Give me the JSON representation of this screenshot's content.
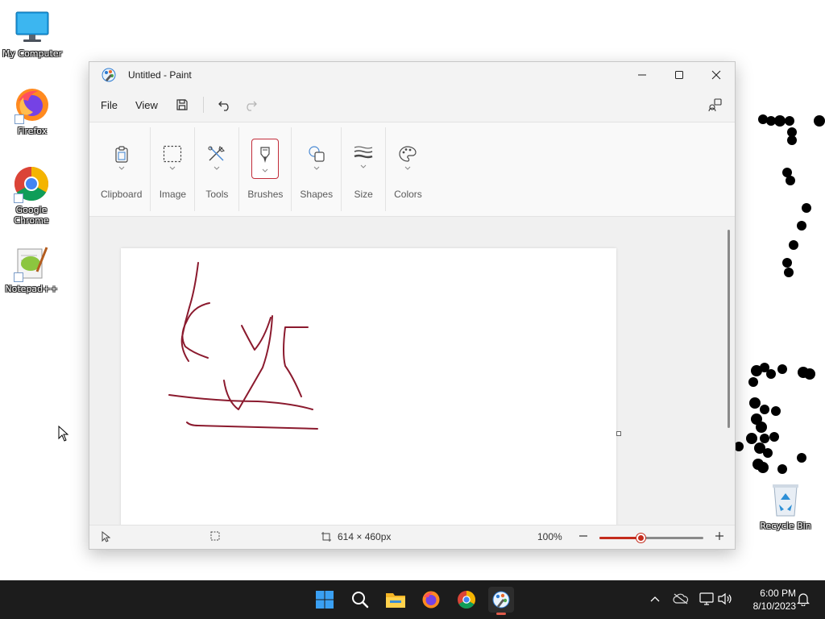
{
  "desktop": {
    "icons": [
      {
        "label": "My Computer"
      },
      {
        "label": "Firefox"
      },
      {
        "label": "Google Chrome"
      },
      {
        "label": "Notepad++"
      },
      {
        "label": "Recycle Bin"
      }
    ]
  },
  "window": {
    "title": "Untitled - Paint",
    "menu": {
      "file": "File",
      "view": "View"
    },
    "ribbon": {
      "groups": [
        {
          "label": "Clipboard"
        },
        {
          "label": "Image"
        },
        {
          "label": "Tools"
        },
        {
          "label": "Brushes"
        },
        {
          "label": "Shapes"
        },
        {
          "label": "Size"
        },
        {
          "label": "Colors"
        }
      ],
      "active_group": "Brushes"
    },
    "status": {
      "canvas_size": "614 × 460px",
      "zoom": "100%",
      "zoom_fraction": 0.4
    }
  },
  "taskbar": {
    "time": "6:00 PM",
    "date": "8/10/2023"
  },
  "colors": {
    "accent": "#c42b1c",
    "stroke": "#8b1a2e",
    "taskbar": "#1c1c1c"
  }
}
